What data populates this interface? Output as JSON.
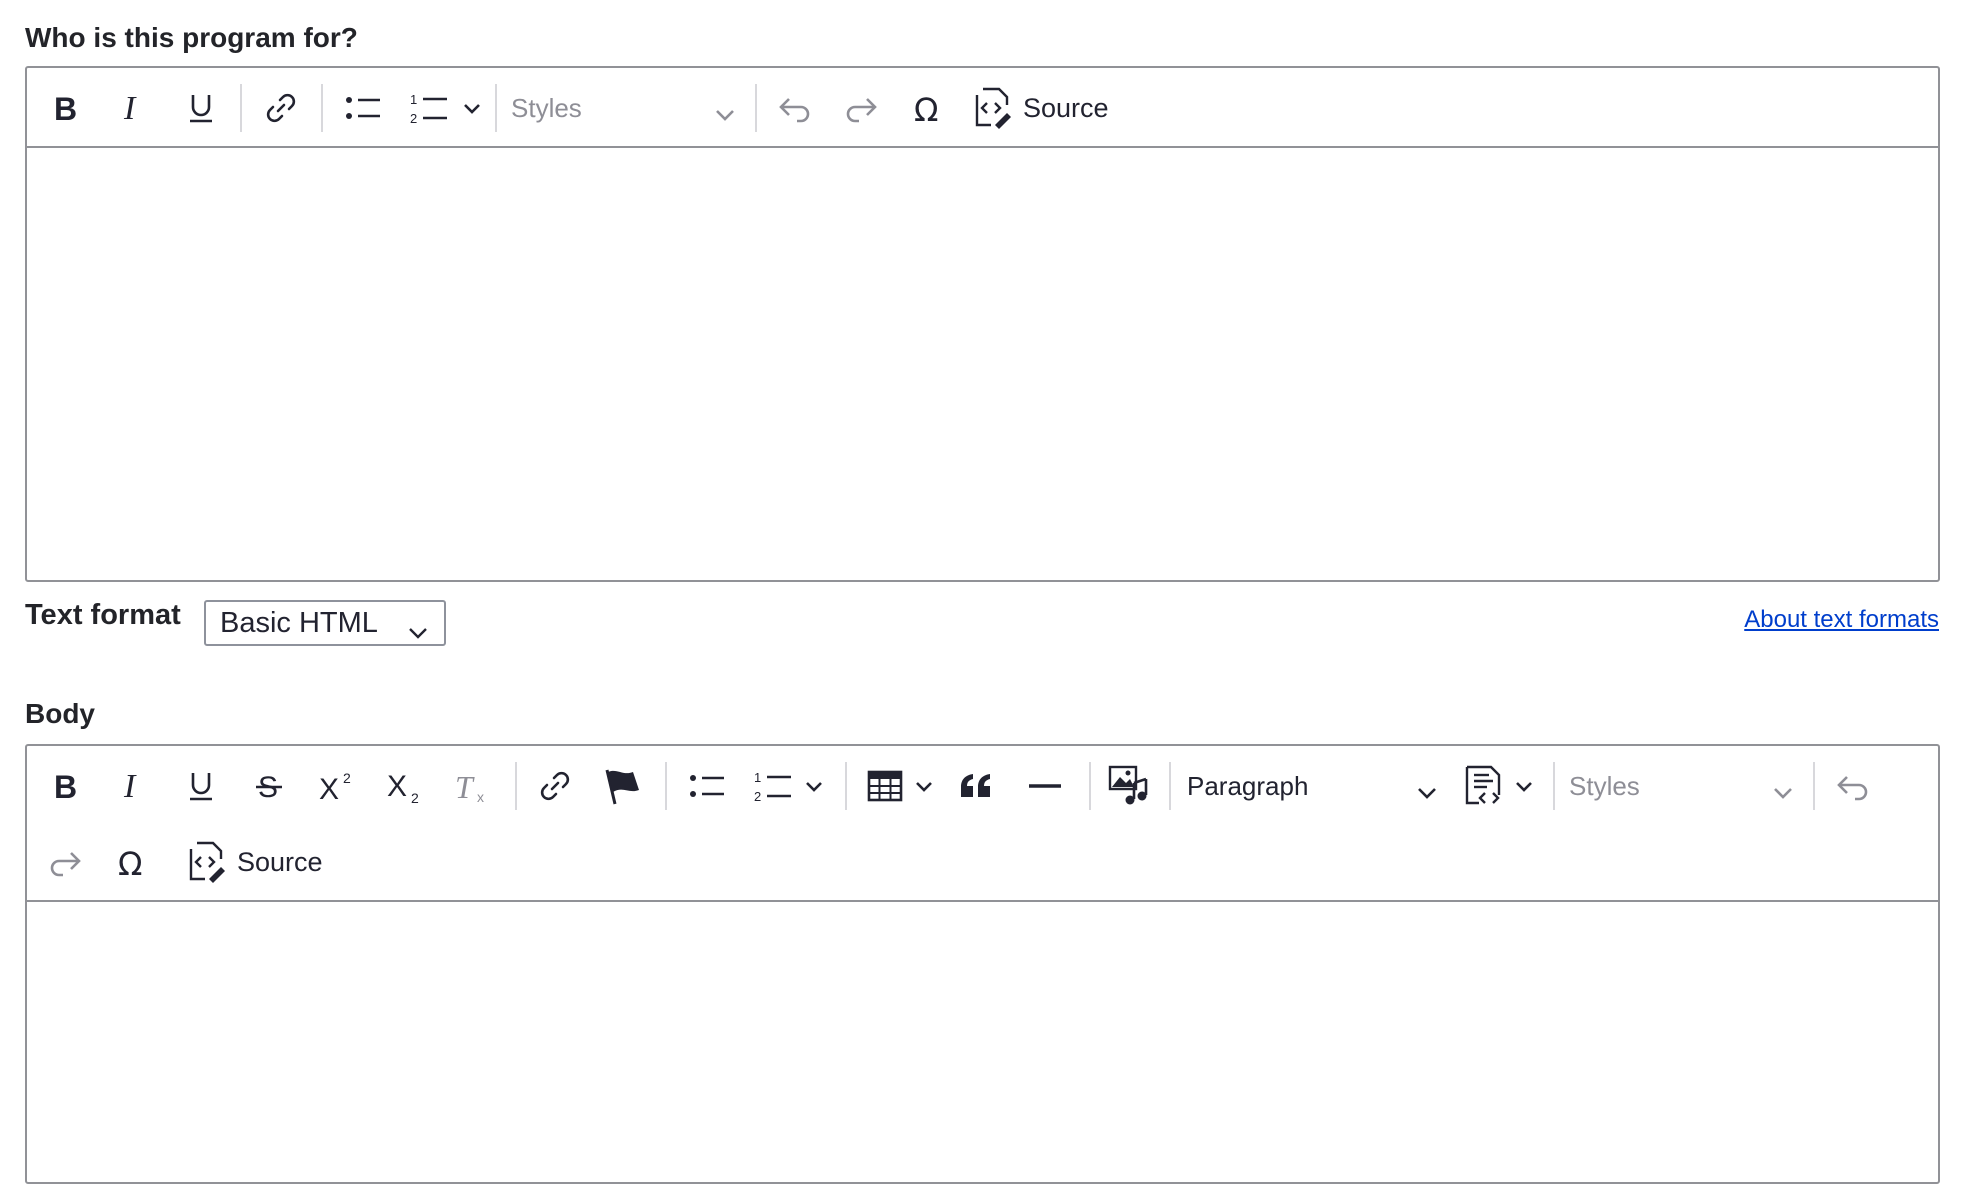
{
  "field1": {
    "label": "Who is this program for?",
    "toolbar": {
      "styles_placeholder": "Styles",
      "source_label": "Source"
    }
  },
  "text_format": {
    "label": "Text format",
    "selected": "Basic HTML",
    "help_link": "About text formats"
  },
  "body": {
    "label": "Body",
    "toolbar": {
      "heading_value": "Paragraph",
      "styles_placeholder": "Styles",
      "source_label": "Source"
    }
  },
  "colors": {
    "link": "#003ecc",
    "border": "#919297",
    "text": "#222330",
    "muted": "#8e8e96"
  }
}
